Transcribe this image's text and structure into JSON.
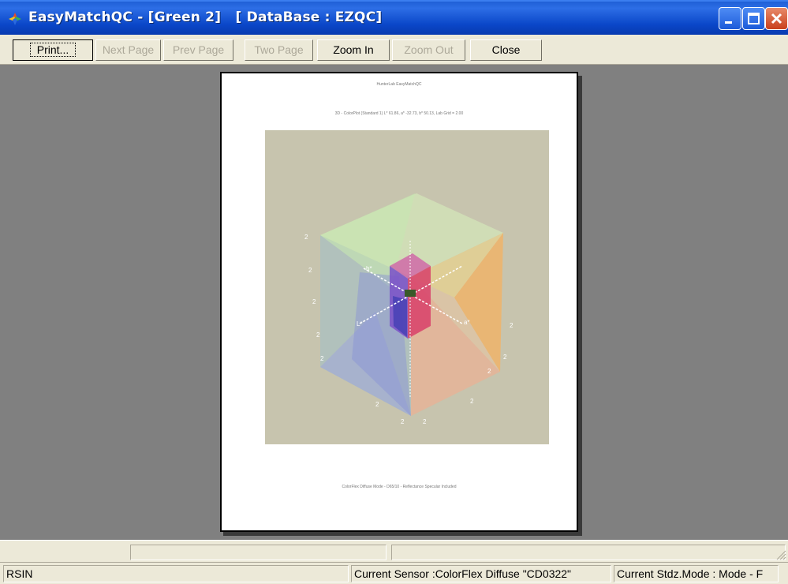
{
  "window": {
    "title": "EasyMatchQC - [Green 2]   [ DataBase : EZQC]",
    "icons": [
      "app-icon",
      "minimize-icon",
      "maximize-icon",
      "close-icon"
    ]
  },
  "toolbar": {
    "print_label": "Print...",
    "next_page_label": "Next Page",
    "prev_page_label": "Prev Page",
    "two_page_label": "Two Page",
    "zoom_in_label": "Zoom In",
    "zoom_out_label": "Zoom Out",
    "close_label": "Close"
  },
  "page": {
    "line1": "HunterLab EasyMatchQC",
    "line2": "3D - ColorPlot (Standard 1) L* 61.86, a* -32.73, b* 50.13, Lab Grid = 2.00",
    "footer": "ColorFlex Diffuse Mode - D65/10 - Reflectance Specular Included"
  },
  "status": {
    "left": "RSIN",
    "sensor": "Current Sensor :ColorFlex Diffuse \"CD0322\"",
    "mode": "Current Stdz.Mode : Mode - F"
  },
  "colors": {
    "titlebar": "#0a46c8",
    "chrome": "#ece9d8",
    "workspace": "#808080",
    "plot_bg": "#c7c4ae"
  }
}
